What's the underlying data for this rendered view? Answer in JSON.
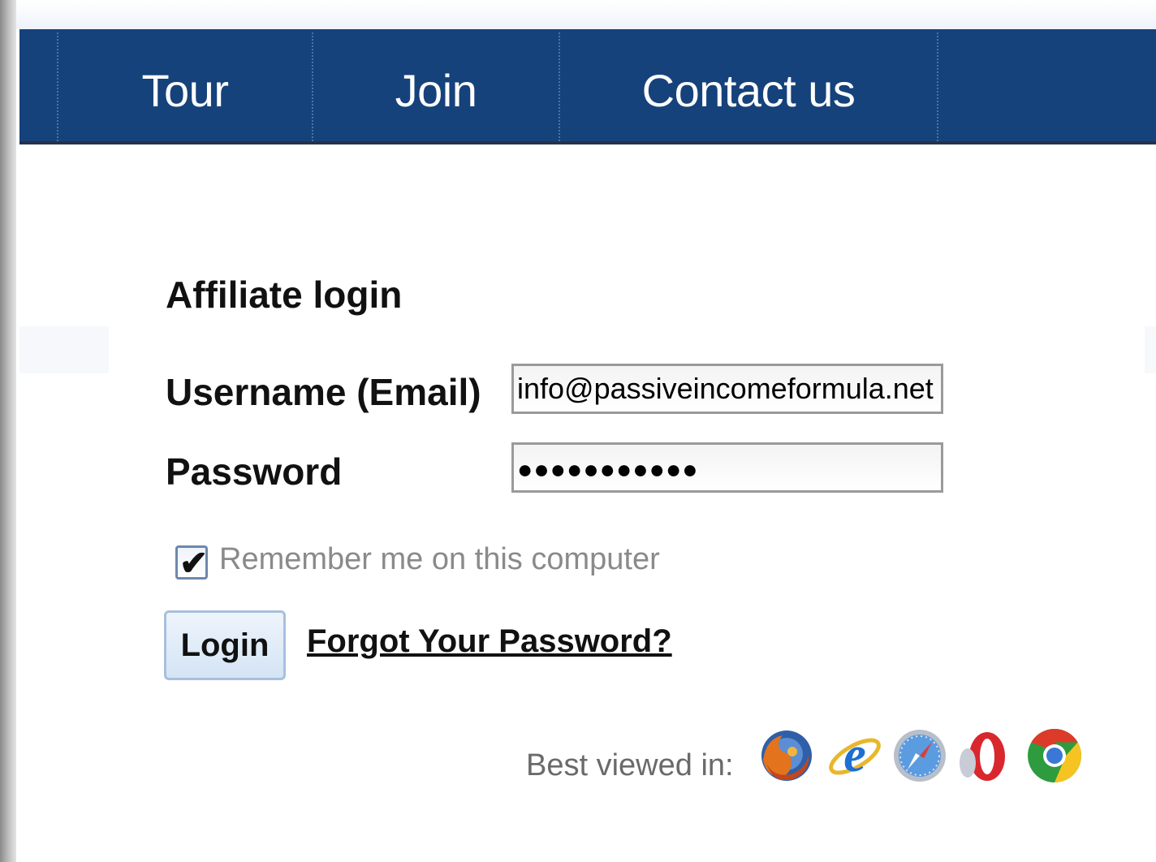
{
  "nav": {
    "items": [
      {
        "label": "Tour"
      },
      {
        "label": "Join"
      },
      {
        "label": "Contact us"
      }
    ]
  },
  "login": {
    "heading": "Affiliate login",
    "username_label": "Username (Email)",
    "username_value": "info@passiveincomeformula.net",
    "password_label": "Password",
    "password_mask": "●●●●●●●●●●●",
    "remember_label": "Remember me on this computer",
    "remember_checked": true,
    "login_button": "Login",
    "forgot_link": "Forgot Your Password?"
  },
  "footer": {
    "best_viewed": "Best viewed in:",
    "browsers": [
      "firefox-icon",
      "internet-explorer-icon",
      "safari-icon",
      "opera-icon",
      "chrome-icon"
    ]
  },
  "colors": {
    "nav_bg": "#16427b",
    "nav_text": "#ffffff",
    "button_bg": "#d4e4f5"
  }
}
